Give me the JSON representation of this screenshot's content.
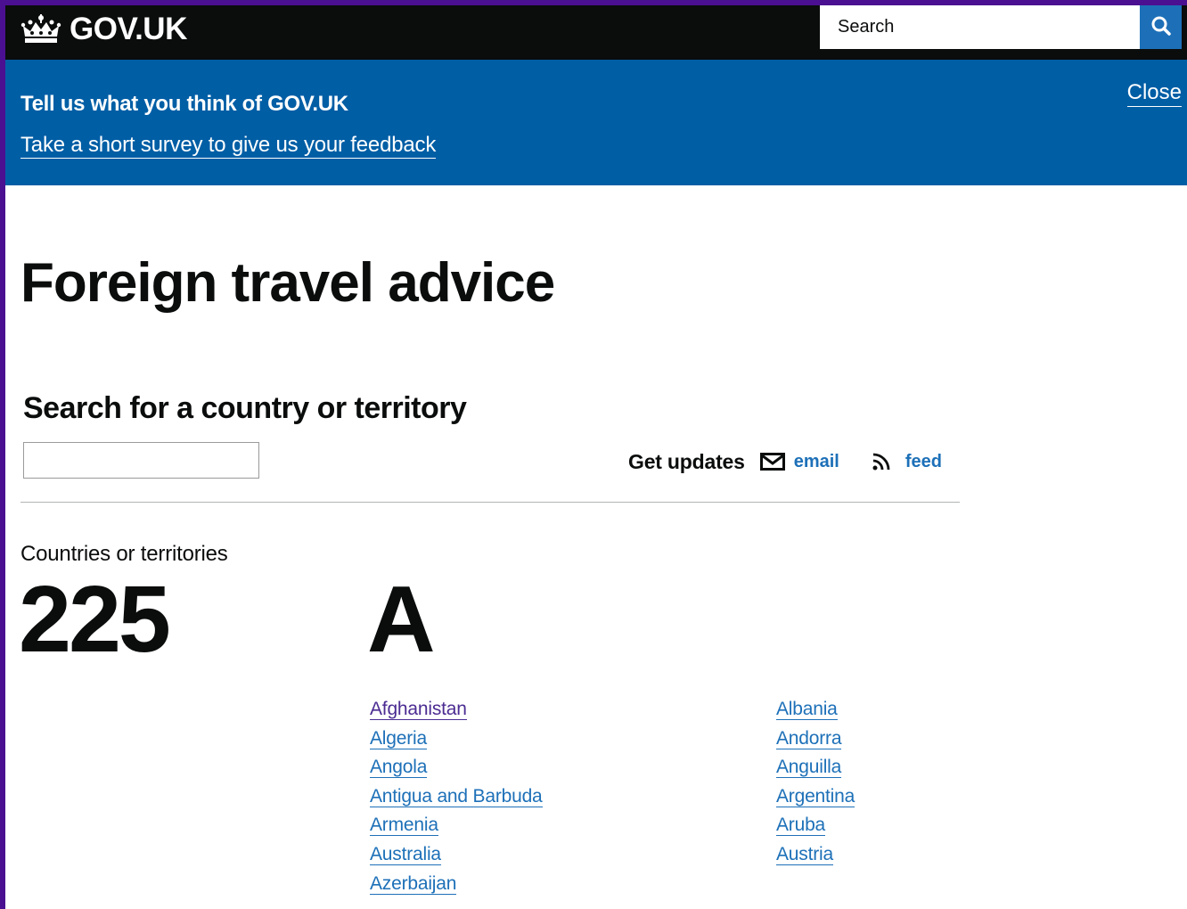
{
  "header": {
    "logo_text": "GOV.UK",
    "search": {
      "placeholder": "Search"
    }
  },
  "banner": {
    "title": "Tell us what you think of GOV.UK",
    "survey_link": "Take a short survey to give us your feedback",
    "close_label": "Close"
  },
  "main": {
    "page_title": "Foreign travel advice",
    "search_heading": "Search for a country or territory",
    "country_search_value": "",
    "updates": {
      "label": "Get updates",
      "email_label": "email",
      "feed_label": "feed"
    },
    "count_label": "Countries or territories",
    "count_value": "225",
    "letter": "A",
    "countries_col1": [
      "Afghanistan",
      "Algeria",
      "Angola",
      "Antigua and Barbuda",
      "Armenia",
      "Australia",
      "Azerbaijan"
    ],
    "countries_col2": [
      "Albania",
      "Andorra",
      "Anguilla",
      "Argentina",
      "Aruba",
      "Austria"
    ]
  },
  "colors": {
    "header_bg": "#0b0c0c",
    "banner_bg": "#005ea5",
    "link": "#1d70b8",
    "visited_link": "#4c2c92",
    "page_border": "#4b0f91"
  }
}
